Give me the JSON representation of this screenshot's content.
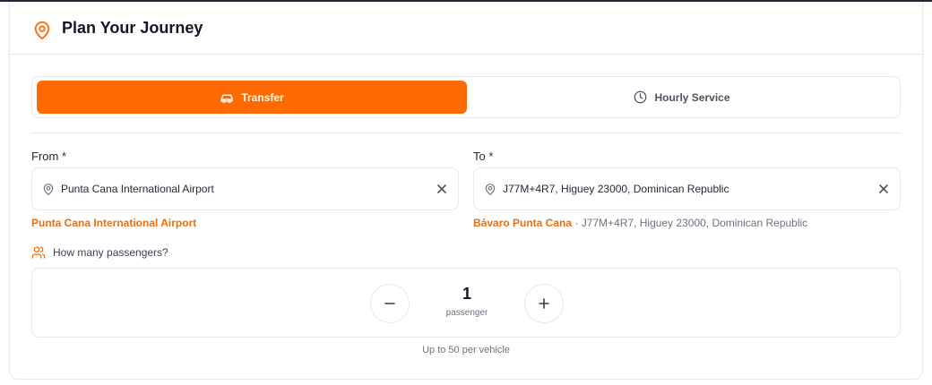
{
  "header": {
    "title": "Plan Your Journey",
    "icon": "location-pin-icon"
  },
  "service_modes": {
    "active": "Transfer",
    "items": [
      {
        "label": "Transfer",
        "icon": "car-icon",
        "selected": true
      },
      {
        "label": "Hourly Service",
        "icon": "clock-icon",
        "selected": false
      }
    ]
  },
  "from": {
    "label": "From *",
    "value": "Punta Cana International Airport",
    "suggestion_name": "Punta Cana International Airport",
    "suggestion_detail": ""
  },
  "to": {
    "label": "To *",
    "value": "J77M+4R7, Higuey 23000, Dominican Republic",
    "suggestion_name": "Bávaro Punta Cana",
    "suggestion_detail": " · J77M+4R7, Higuey 23000, Dominican Republic"
  },
  "passengers": {
    "label": "How many passengers?",
    "count": "1",
    "unit": "passenger",
    "limit_note": "Up to 50 per vehicle"
  },
  "colors": {
    "accent": "#ff6a00",
    "accent_text": "#e8700f",
    "border": "#e5e7eb"
  }
}
